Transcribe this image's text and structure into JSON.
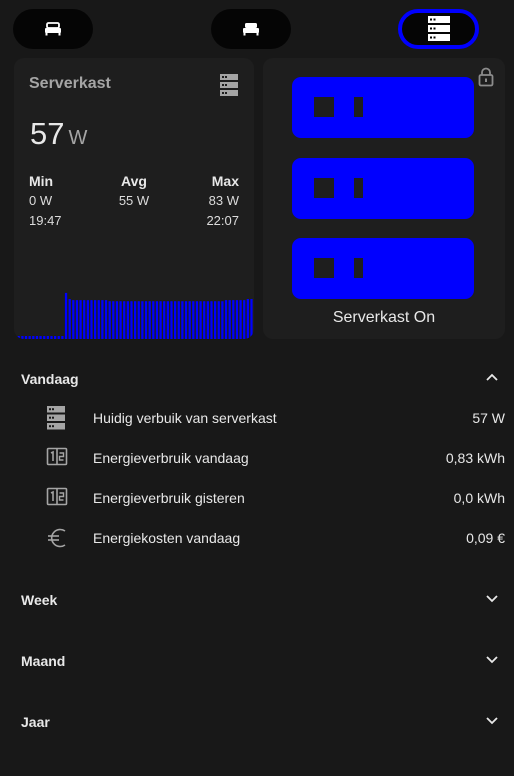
{
  "nav": {
    "items": [
      {
        "icon": "bed-icon",
        "active": false
      },
      {
        "icon": "bed-icon",
        "active": false
      },
      {
        "icon": "server-icon",
        "active": true
      }
    ]
  },
  "power_card": {
    "title": "Serverkast",
    "value": "57",
    "unit": "W",
    "min_label": "Min",
    "min_value": "0 W",
    "min_time": "19:47",
    "avg_label": "Avg",
    "avg_value": "55 W",
    "max_label": "Max",
    "max_value": "83 W",
    "max_time": "22:07",
    "icon": "server-icon"
  },
  "chart_data": {
    "type": "bar",
    "values": [
      0,
      0,
      0,
      0,
      0,
      0,
      0,
      0,
      0,
      0,
      0,
      0,
      0,
      0,
      83,
      72,
      70,
      70,
      70,
      70,
      70,
      70,
      70,
      70,
      70,
      70,
      68,
      68,
      68,
      68,
      68,
      68,
      68,
      68,
      68,
      68,
      68,
      68,
      68,
      68,
      68,
      68,
      68,
      68,
      68,
      68,
      68,
      68,
      68,
      68,
      68,
      68,
      68,
      68,
      68,
      68,
      68,
      68,
      70,
      70,
      70,
      70,
      70,
      70,
      72,
      72
    ],
    "color": "#0000ff",
    "ylim": [
      0,
      90
    ]
  },
  "switch_card": {
    "label": "Serverkast On",
    "lock_icon": "lock-icon",
    "accent": "#0000ff"
  },
  "sections": {
    "today": {
      "title": "Vandaag",
      "expanded": true
    },
    "week": {
      "title": "Week"
    },
    "month": {
      "title": "Maand"
    },
    "year": {
      "title": "Jaar"
    }
  },
  "rows": [
    {
      "icon": "server-icon",
      "label": "Huidig verbuik van serverkast",
      "value": "57 W"
    },
    {
      "icon": "counter-icon",
      "label": "Energieverbruik vandaag",
      "value": "0,83 kWh"
    },
    {
      "icon": "counter-icon",
      "label": "Energieverbruik gisteren",
      "value": "0,0 kWh"
    },
    {
      "icon": "euro-icon",
      "label": "Energiekosten vandaag",
      "value": "0,09 €"
    }
  ]
}
